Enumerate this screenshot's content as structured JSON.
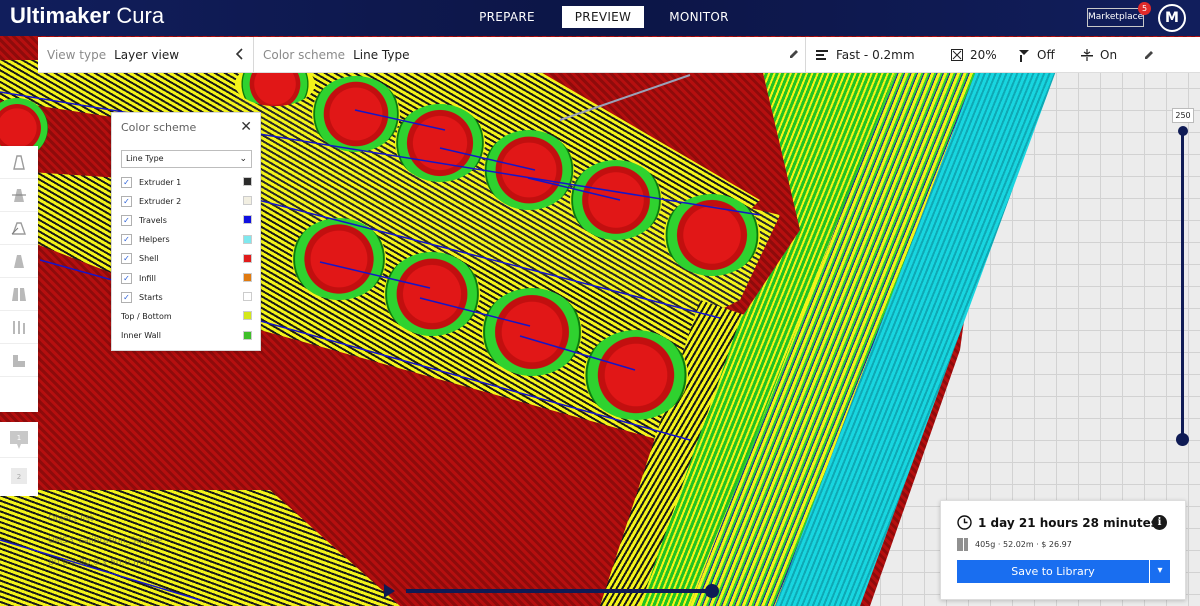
{
  "app": {
    "title_bold": "Ultimaker",
    "title_light": "Cura"
  },
  "stages": [
    {
      "label": "PREPARE"
    },
    {
      "label": "PREVIEW"
    },
    {
      "label": "MONITOR"
    }
  ],
  "header": {
    "marketplace_label": "Marketplace",
    "marketplace_badge": "5",
    "avatar_initial": "M"
  },
  "toolbar": {
    "view_type_label": "View type",
    "view_type_value": "Layer view",
    "color_scheme_label": "Color scheme",
    "color_scheme_value": "Line Type",
    "profile": "Fast - 0.2mm",
    "infill": "20%",
    "support": "Off",
    "adhesion": "On"
  },
  "color_scheme_panel": {
    "title": "Color scheme",
    "selected": "Line Type",
    "items": [
      {
        "label": "Extruder 1",
        "checked": true,
        "color": "#2b2b2b"
      },
      {
        "label": "Extruder 2",
        "checked": true,
        "color": "#f2efe2"
      },
      {
        "label": "Travels",
        "checked": true,
        "color": "#1010e0"
      },
      {
        "label": "Helpers",
        "checked": true,
        "color": "#7fe8ee"
      },
      {
        "label": "Shell",
        "checked": true,
        "color": "#e01b1b"
      },
      {
        "label": "Infill",
        "checked": true,
        "color": "#e07a10"
      },
      {
        "label": "Starts",
        "checked": true,
        "color": "#ffffff"
      },
      {
        "label": "Top / Bottom",
        "checked": false,
        "color": "#d4e81a"
      },
      {
        "label": "Inner Wall",
        "checked": false,
        "color": "#3fbf28"
      }
    ]
  },
  "layer_slider": {
    "top_value": "250"
  },
  "object_info": {
    "title": "Object list",
    "name": "UMS3_calibration_Square",
    "dims": "80.0 x 80.0 x 50.0 mm"
  },
  "summary": {
    "print_time": "1 day 21 hours 28 minutes",
    "material": "405g · 52.02m · $ 26.97",
    "save_label": "Save to Library"
  },
  "colors": {
    "header_bg": "#0c1546",
    "accent": "#196ef0",
    "slider": "#0f1b55"
  }
}
